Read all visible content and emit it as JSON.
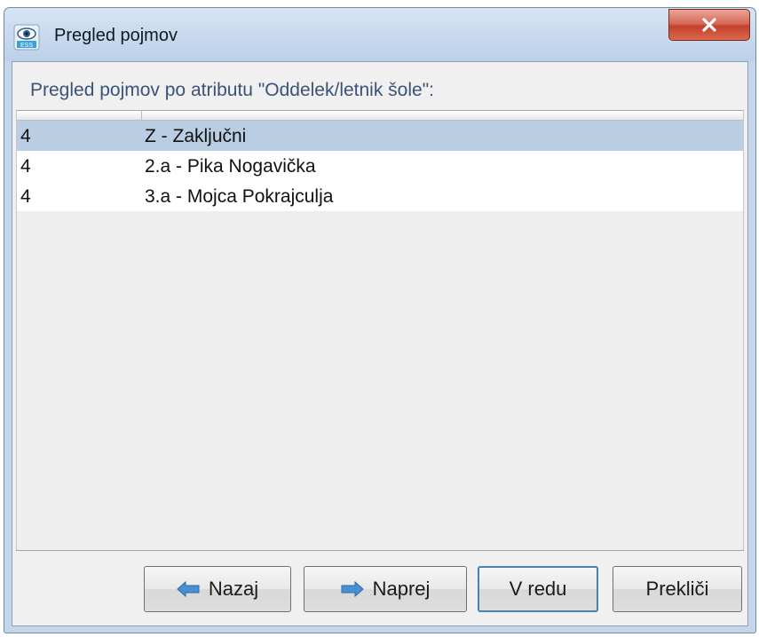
{
  "window": {
    "title": "Pregled pojmov",
    "app_icon": "ess-eye-icon",
    "close_icon": "close-icon"
  },
  "prompt": "Pregled pojmov po atributu \"Oddelek/letnik šole\":",
  "list": {
    "rows": [
      {
        "col1": "4",
        "col2": "Z  -  Zaključni",
        "selected": true
      },
      {
        "col1": "4",
        "col2": "2.a  -  Pika Nogavička",
        "selected": false
      },
      {
        "col1": "4",
        "col2": "3.a  -  Mojca Pokrajculja",
        "selected": false
      }
    ]
  },
  "buttons": {
    "back_label": "Nazaj",
    "back_icon": "arrow-left-icon",
    "next_label": "Naprej",
    "next_icon": "arrow-right-icon",
    "ok_label": "V redu",
    "cancel_label": "Prekliči"
  },
  "colors": {
    "title_bar": "#c5d6ea",
    "selection": "#b9cde3",
    "prompt_text": "#3b5278",
    "close_button": "#c4412d",
    "arrow_icon": "#4a8fd0"
  }
}
